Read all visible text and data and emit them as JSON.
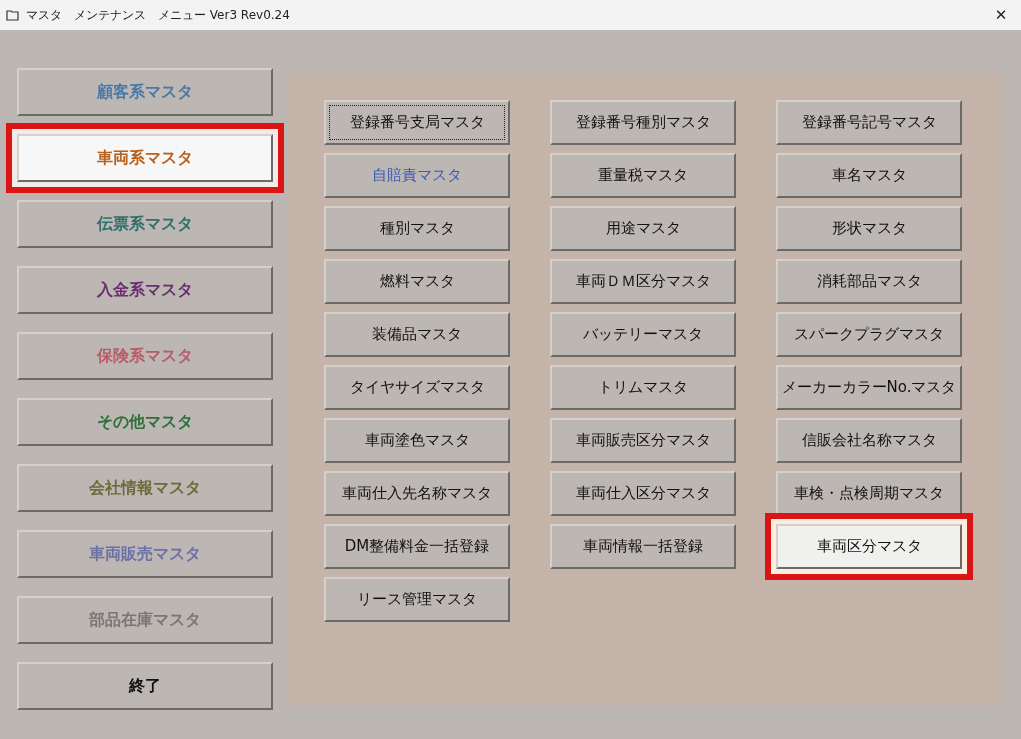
{
  "window": {
    "title": "マスタ　メンテナンス　メニュー Ver3 Rev0.24",
    "close": "✕"
  },
  "categories": [
    {
      "label": "顧客系マスタ",
      "color": "#4a78a6",
      "selected": false
    },
    {
      "label": "車両系マスタ",
      "color": "#b8601e",
      "selected": true
    },
    {
      "label": "伝票系マスタ",
      "color": "#2f6e6a",
      "selected": false
    },
    {
      "label": "入金系マスタ",
      "color": "#6a2f6e",
      "selected": false
    },
    {
      "label": "保険系マスタ",
      "color": "#b85a68",
      "selected": false
    },
    {
      "label": "その他マスタ",
      "color": "#2e6e3a",
      "selected": false
    },
    {
      "label": "会社情報マスタ",
      "color": "#6e6a3a",
      "selected": false
    },
    {
      "label": "車両販売マスタ",
      "color": "#6a70a8",
      "selected": false
    },
    {
      "label": "部品在庫マスタ",
      "color": "#7a7674",
      "selected": false
    },
    {
      "label": "終了",
      "color": "#111111",
      "selected": false
    }
  ],
  "masters": [
    {
      "label": "登録番号支局マスタ",
      "color": "#111111",
      "selected": false,
      "focused": true
    },
    {
      "label": "登録番号種別マスタ",
      "color": "#111111",
      "selected": false,
      "focused": false
    },
    {
      "label": "登録番号記号マスタ",
      "color": "#111111",
      "selected": false,
      "focused": false
    },
    {
      "label": "自賠責マスタ",
      "color": "#3a5ab8",
      "selected": false,
      "focused": false
    },
    {
      "label": "重量税マスタ",
      "color": "#111111",
      "selected": false,
      "focused": false
    },
    {
      "label": "車名マスタ",
      "color": "#111111",
      "selected": false,
      "focused": false
    },
    {
      "label": "種別マスタ",
      "color": "#111111",
      "selected": false,
      "focused": false
    },
    {
      "label": "用途マスタ",
      "color": "#111111",
      "selected": false,
      "focused": false
    },
    {
      "label": "形状マスタ",
      "color": "#111111",
      "selected": false,
      "focused": false
    },
    {
      "label": "燃料マスタ",
      "color": "#111111",
      "selected": false,
      "focused": false
    },
    {
      "label": "車両ＤＭ区分マスタ",
      "color": "#111111",
      "selected": false,
      "focused": false
    },
    {
      "label": "消耗部品マスタ",
      "color": "#111111",
      "selected": false,
      "focused": false
    },
    {
      "label": "装備品マスタ",
      "color": "#111111",
      "selected": false,
      "focused": false
    },
    {
      "label": "バッテリーマスタ",
      "color": "#111111",
      "selected": false,
      "focused": false
    },
    {
      "label": "スパークプラグマスタ",
      "color": "#111111",
      "selected": false,
      "focused": false
    },
    {
      "label": "タイヤサイズマスタ",
      "color": "#111111",
      "selected": false,
      "focused": false
    },
    {
      "label": "トリムマスタ",
      "color": "#111111",
      "selected": false,
      "focused": false
    },
    {
      "label": "メーカーカラーNo.マスタ",
      "color": "#111111",
      "selected": false,
      "focused": false
    },
    {
      "label": "車両塗色マスタ",
      "color": "#111111",
      "selected": false,
      "focused": false
    },
    {
      "label": "車両販売区分マスタ",
      "color": "#111111",
      "selected": false,
      "focused": false
    },
    {
      "label": "信販会社名称マスタ",
      "color": "#111111",
      "selected": false,
      "focused": false
    },
    {
      "label": "車両仕入先名称マスタ",
      "color": "#111111",
      "selected": false,
      "focused": false
    },
    {
      "label": "車両仕入区分マスタ",
      "color": "#111111",
      "selected": false,
      "focused": false
    },
    {
      "label": "車検・点検周期マスタ",
      "color": "#111111",
      "selected": false,
      "focused": false
    },
    {
      "label": "DM整備料金一括登録",
      "color": "#111111",
      "selected": false,
      "focused": false
    },
    {
      "label": "車両情報一括登録",
      "color": "#111111",
      "selected": false,
      "focused": false
    },
    {
      "label": "車両区分マスタ",
      "color": "#111111",
      "selected": true,
      "focused": false
    },
    {
      "label": "リース管理マスタ",
      "color": "#111111",
      "selected": false,
      "focused": false
    }
  ]
}
